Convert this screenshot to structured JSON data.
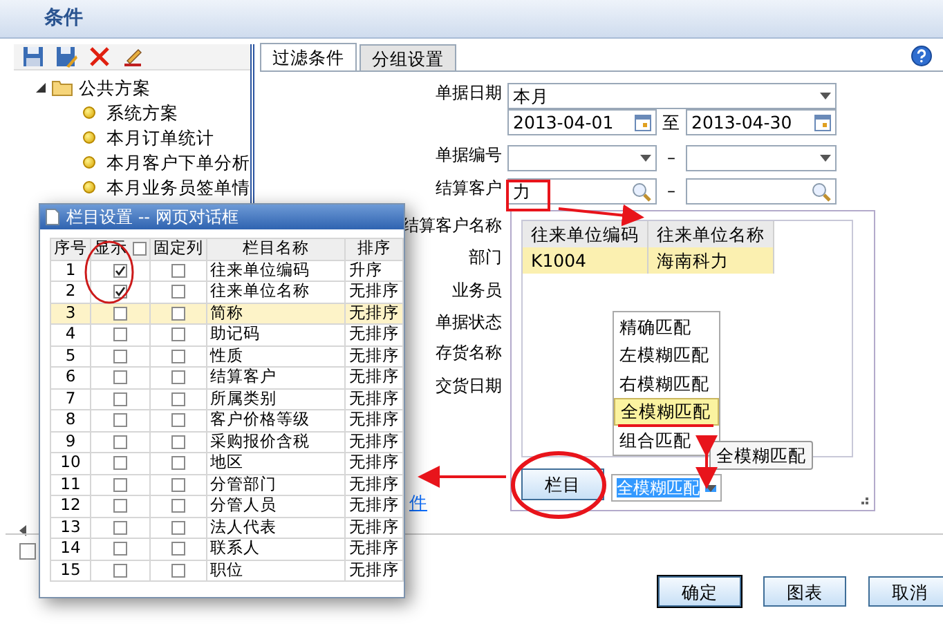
{
  "window": {
    "title": "条件"
  },
  "toolbar": [
    {
      "kind": "save"
    },
    {
      "kind": "saveas"
    },
    {
      "kind": "delete"
    },
    {
      "kind": "edit"
    }
  ],
  "tree": [
    {
      "label": "公共方案",
      "expanded": true,
      "children": [
        {
          "label": "系统方案"
        },
        {
          "label": "本月订单统计"
        },
        {
          "label": "本月客户下单分析"
        },
        {
          "label": "本月业务员签单情"
        }
      ]
    }
  ],
  "footer_checkbox": {
    "checked": false
  },
  "tabs": [
    {
      "label": "过滤条件",
      "selected": true
    },
    {
      "label": "分组设置",
      "selected": false
    }
  ],
  "form": {
    "date_label": "单据日期",
    "period": "本月",
    "date_from": "2013-04-01",
    "to_label": "至",
    "date_to": "2013-04-30",
    "number_label": "单据编号",
    "dash": "–",
    "customer_label": "结算客户",
    "customer_value": "力",
    "labels": [
      "结算客户名称",
      "部门",
      "业务员",
      "单据状态",
      "存货名称",
      "交货日期"
    ],
    "link": "件"
  },
  "lookup": {
    "columns": [
      "往来单位编码",
      "往来单位名称"
    ],
    "rows": [
      {
        "cells": [
          "K1004",
          "海南科力"
        ],
        "selected": true
      }
    ],
    "column_button": "栏目",
    "match_value": "全模糊匹配",
    "match_options": [
      {
        "label": "精确匹配",
        "selected": false
      },
      {
        "label": "左模糊匹配",
        "selected": false
      },
      {
        "label": "右模糊匹配",
        "selected": false
      },
      {
        "label": "全模糊匹配",
        "selected": true
      },
      {
        "label": "组合匹配",
        "selected": false
      }
    ],
    "tooltip": "全模糊匹配"
  },
  "buttons": [
    "确定",
    "图表",
    "取消"
  ],
  "dialog": {
    "title": "栏目设置 -- 网页对话框",
    "columns": [
      "序号",
      "显示",
      "固定列",
      "栏目名称",
      "排序"
    ],
    "show_all_checked": false,
    "rows": [
      {
        "no": "1",
        "shown": true,
        "fixed": false,
        "name": "往来单位编码",
        "sort": "升序",
        "selected": false
      },
      {
        "no": "2",
        "shown": true,
        "fixed": false,
        "name": "往来单位名称",
        "sort": "无排序",
        "selected": false
      },
      {
        "no": "3",
        "shown": false,
        "fixed": false,
        "name": "简称",
        "sort": "无排序",
        "selected": true
      },
      {
        "no": "4",
        "shown": false,
        "fixed": false,
        "name": "助记码",
        "sort": "无排序",
        "selected": false
      },
      {
        "no": "5",
        "shown": false,
        "fixed": false,
        "name": "性质",
        "sort": "无排序",
        "selected": false
      },
      {
        "no": "6",
        "shown": false,
        "fixed": false,
        "name": "结算客户",
        "sort": "无排序",
        "selected": false
      },
      {
        "no": "7",
        "shown": false,
        "fixed": false,
        "name": "所属类别",
        "sort": "无排序",
        "selected": false
      },
      {
        "no": "8",
        "shown": false,
        "fixed": false,
        "name": "客户价格等级",
        "sort": "无排序",
        "selected": false
      },
      {
        "no": "9",
        "shown": false,
        "fixed": false,
        "name": "采购报价含税",
        "sort": "无排序",
        "selected": false
      },
      {
        "no": "10",
        "shown": false,
        "fixed": false,
        "name": "地区",
        "sort": "无排序",
        "selected": false
      },
      {
        "no": "11",
        "shown": false,
        "fixed": false,
        "name": "分管部门",
        "sort": "无排序",
        "selected": false
      },
      {
        "no": "12",
        "shown": false,
        "fixed": false,
        "name": "分管人员",
        "sort": "无排序",
        "selected": false
      },
      {
        "no": "13",
        "shown": false,
        "fixed": false,
        "name": "法人代表",
        "sort": "无排序",
        "selected": false
      },
      {
        "no": "14",
        "shown": false,
        "fixed": false,
        "name": "联系人",
        "sort": "无排序",
        "selected": false
      },
      {
        "no": "15",
        "shown": false,
        "fixed": false,
        "name": "职位",
        "sort": "无排序",
        "selected": false
      }
    ]
  }
}
